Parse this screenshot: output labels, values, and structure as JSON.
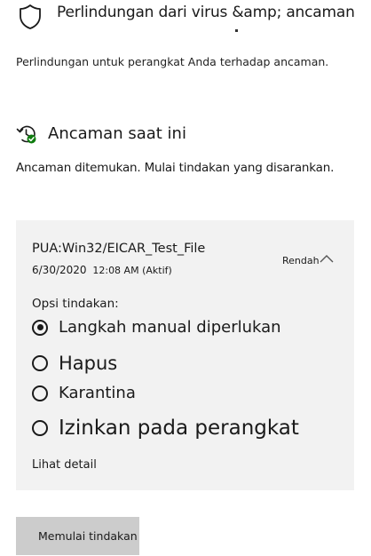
{
  "header": {
    "title": "Perlindungan dari virus &amp; ancaman",
    "description": "Perlindungan untuk perangkat Anda terhadap ancaman.",
    "icon": "shield-icon"
  },
  "current_threats": {
    "title": "Ancaman saat ini",
    "description": "Ancaman ditemukan. Mulai tindakan yang disarankan.",
    "icon": "threat-history-icon",
    "icon_accent": "#107c10"
  },
  "threat": {
    "name": "PUA:Win32/EICAR_Test_File",
    "date": "6/30/2020",
    "time_status": "12:08 AM (Aktif)",
    "level": "Rendah",
    "options_label": "Opsi tindakan:",
    "options": [
      {
        "label": "Langkah manual diperlukan",
        "selected": true
      },
      {
        "label": "Hapus",
        "selected": false
      },
      {
        "label": "Karantina",
        "selected": false
      },
      {
        "label": "Izinkan pada perangkat",
        "selected": false
      }
    ],
    "details_link": "Lihat detail"
  },
  "actions": {
    "start_label": "Memulai tindakan"
  },
  "colors": {
    "card_background": "#f2f2f2",
    "button_background": "#cccccc",
    "text": "#1a1a1a"
  }
}
